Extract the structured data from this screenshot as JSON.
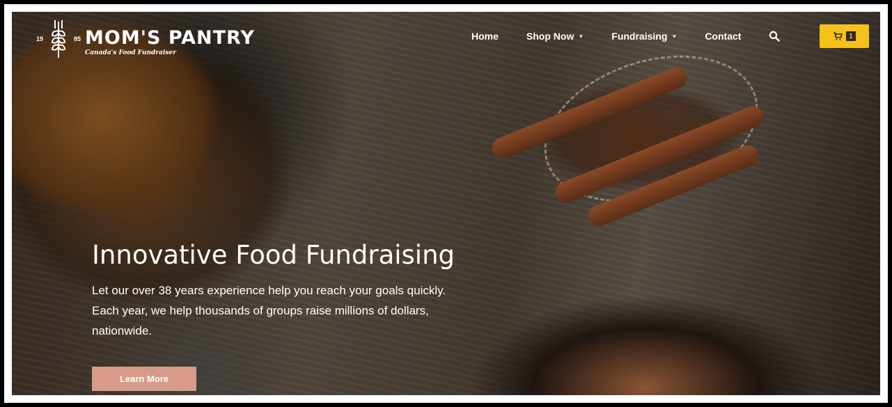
{
  "logo": {
    "year_left": "19",
    "year_right": "85",
    "brand": "MOM'S PANTRY",
    "tagline": "Canada's Food Fundraiser",
    "icon": "wheat-icon"
  },
  "nav": {
    "home": "Home",
    "shop_now": "Shop Now",
    "fundraising": "Fundraising",
    "contact": "Contact",
    "search_icon": "search-icon"
  },
  "cart": {
    "icon": "cart-icon",
    "count": "1",
    "color": "#f5c11a"
  },
  "hero": {
    "headline": "Innovative Food Fundraising",
    "line1": "Let our over 38 years experience help you reach your goals quickly.",
    "line2": "Each year, we help thousands of groups raise millions of dollars,",
    "line3": "nationwide.",
    "cta_label": "Learn More",
    "cta_color": "#d89a89"
  }
}
